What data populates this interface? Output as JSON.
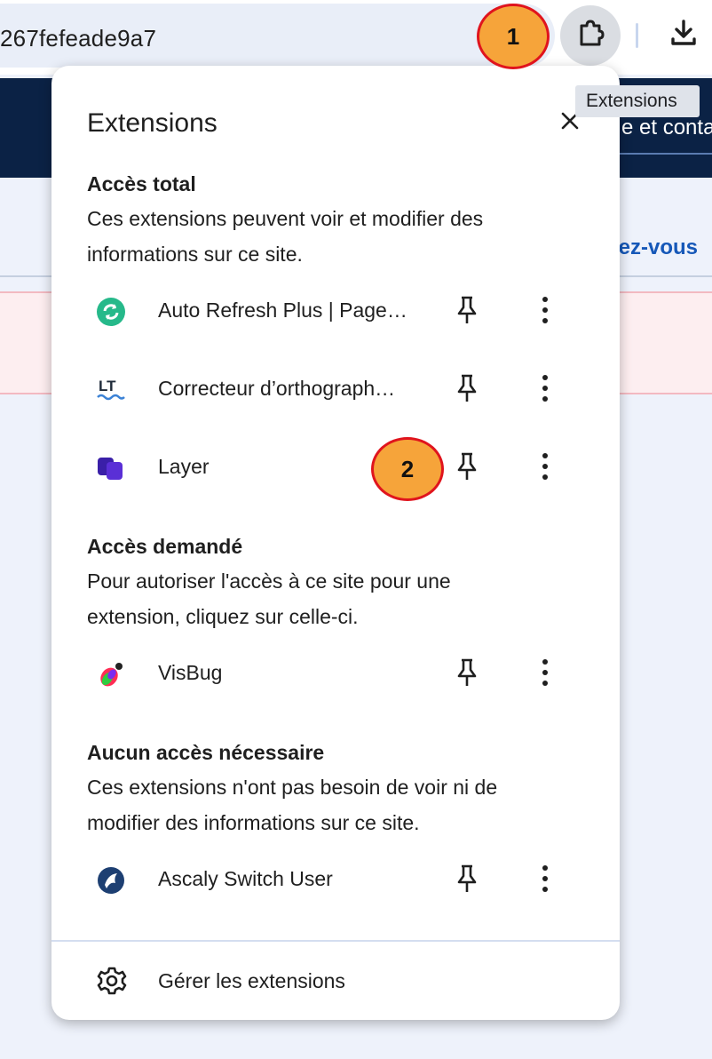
{
  "browser": {
    "url_fragment": "267fefeade9a7",
    "extensions_tooltip": "Extensions"
  },
  "page": {
    "header_link": "e et conta",
    "nav_link": "lez-vous"
  },
  "markers": {
    "first": "1",
    "second": "2"
  },
  "popup": {
    "title": "Extensions",
    "sections": [
      {
        "title": "Accès total",
        "description": "Ces extensions peuvent voir et modifier des informations sur ce site.",
        "extensions": [
          {
            "name": "Auto Refresh Plus | Page…",
            "icon": "auto-refresh-icon"
          },
          {
            "name": "Correcteur d’orthograph…",
            "icon": "languagetool-icon"
          },
          {
            "name": "Layer",
            "icon": "layer-icon"
          }
        ]
      },
      {
        "title": "Accès demandé",
        "description": "Pour autoriser l'accès à ce site pour une extension, cliquez sur celle-ci.",
        "extensions": [
          {
            "name": "VisBug",
            "icon": "visbug-icon"
          }
        ]
      },
      {
        "title": "Aucun accès nécessaire",
        "description": "Ces extensions n'ont pas besoin de voir ni de modifier des informations sur ce site.",
        "extensions": [
          {
            "name": "Ascaly Switch User",
            "icon": "ascaly-icon"
          }
        ]
      }
    ],
    "manage_label": "Gérer les extensions"
  },
  "colors": {
    "marker_fill": "#f6a43a",
    "marker_border": "#e0141d",
    "page_header": "#0b2245",
    "link_blue": "#1658b8"
  }
}
